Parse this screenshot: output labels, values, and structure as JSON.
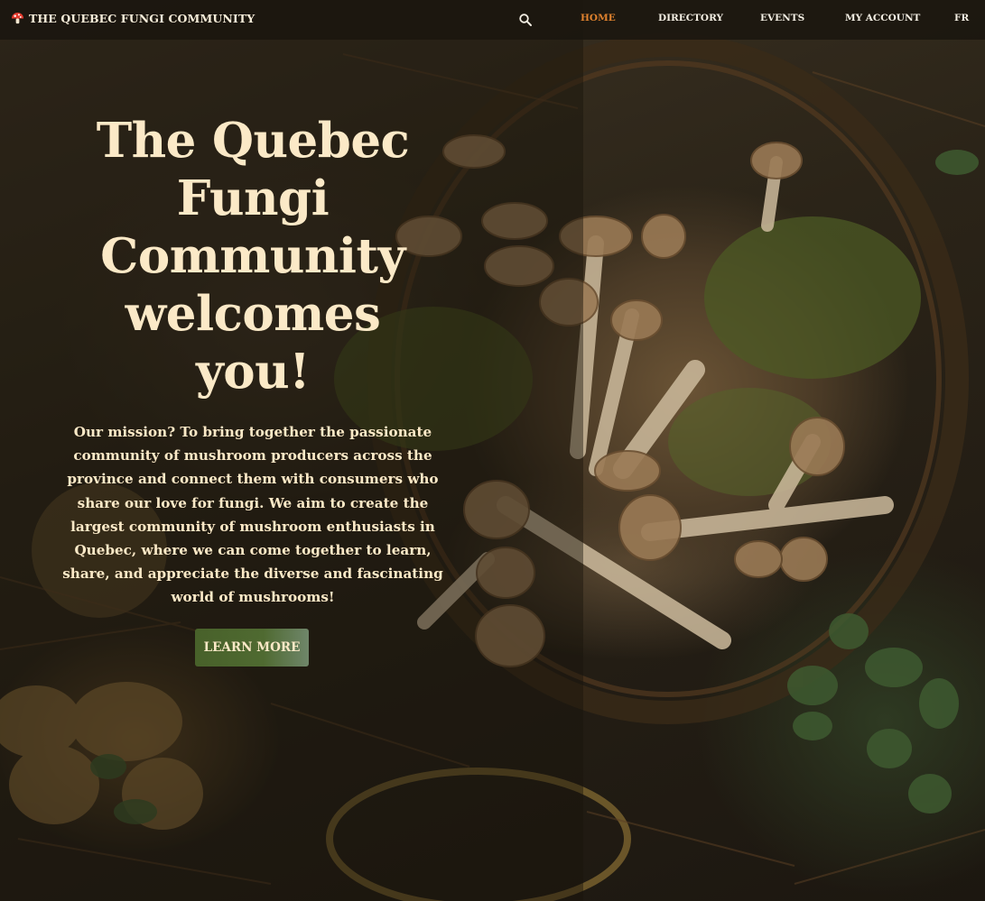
{
  "nav": {
    "brand": "THE QUEBEC FUNGI COMMUNITY",
    "brand_icon": "mushroom-icon",
    "search_icon": "search-icon",
    "links": [
      {
        "label": "HOME",
        "active": true
      },
      {
        "label": "DIRECTORY",
        "active": false
      },
      {
        "label": "EVENTS",
        "active": false
      },
      {
        "label": "MY ACCOUNT",
        "active": false
      },
      {
        "label": "FR",
        "active": false
      }
    ]
  },
  "hero": {
    "title": "The Quebec Fungi Community welcomes you!",
    "mission": "Our mission? To bring together the passionate community of mushroom producers across the province and connect them with consumers who share our love for fungi. We aim to create the largest community of mushroom enthusiasts in Quebec, where we can come together to learn, share, and appreciate the diverse and fascinating world of mushrooms!",
    "cta_label": "LEARN MORE"
  },
  "colors": {
    "accent_active": "#e0822e",
    "hero_text": "#fbe9c7",
    "cta_green": "#4f6a31",
    "nav_bg": "#1a160f"
  }
}
